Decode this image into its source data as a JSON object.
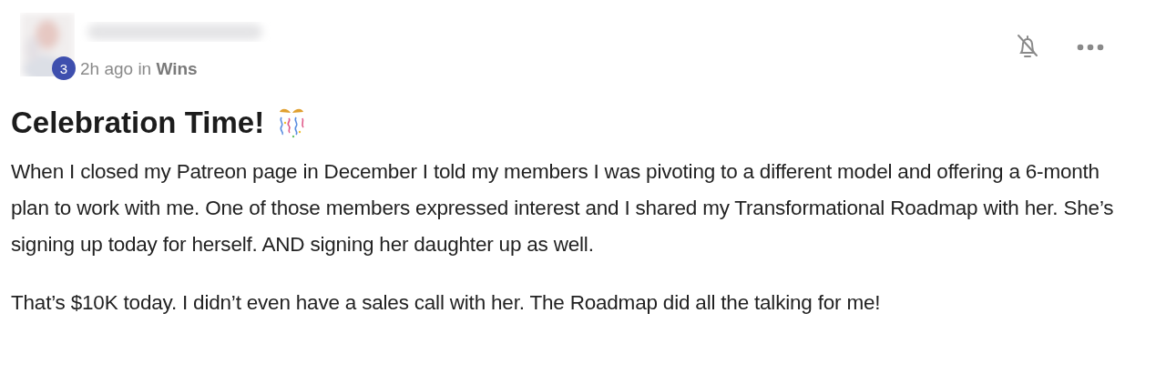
{
  "post": {
    "author_level": "3",
    "meta": "2h ago in **Wins**",
    "title": "Celebration Time!",
    "paragraphs": [
      "When I closed my Patreon page in December I told my members I was pivoting to a different model and offering a 6-month plan to work with me. One of those members expressed interest and I shared my Transformational Roadmap with her. She’s signing up today for herself. AND signing her daughter up as well.",
      "That’s $10K today. I didn’t even have a sales call with her. The Roadmap did all the talking for me!"
    ]
  }
}
